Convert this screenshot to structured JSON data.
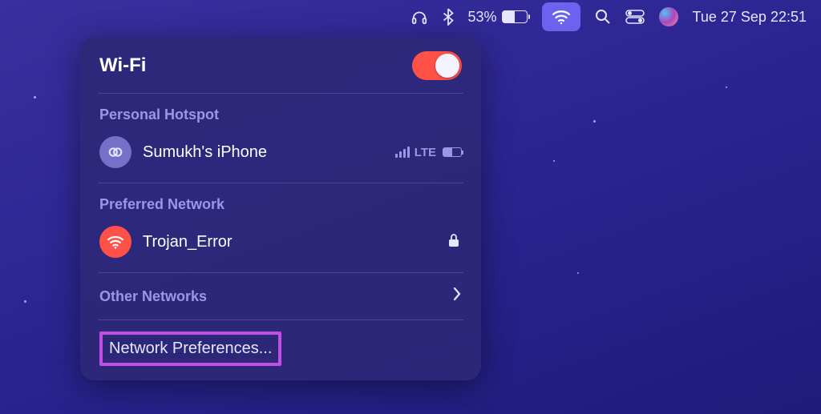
{
  "menubar": {
    "battery_pct": "53%",
    "datetime": "Tue 27 Sep  22:51"
  },
  "wifi_panel": {
    "title": "Wi-Fi",
    "toggle_on": true,
    "hotspot": {
      "label": "Personal Hotspot",
      "device": "Sumukh's iPhone",
      "carrier": "LTE"
    },
    "preferred": {
      "label": "Preferred Network",
      "ssid": "Trojan_Error",
      "locked": true
    },
    "other_label": "Other Networks",
    "prefs_label": "Network Preferences..."
  }
}
